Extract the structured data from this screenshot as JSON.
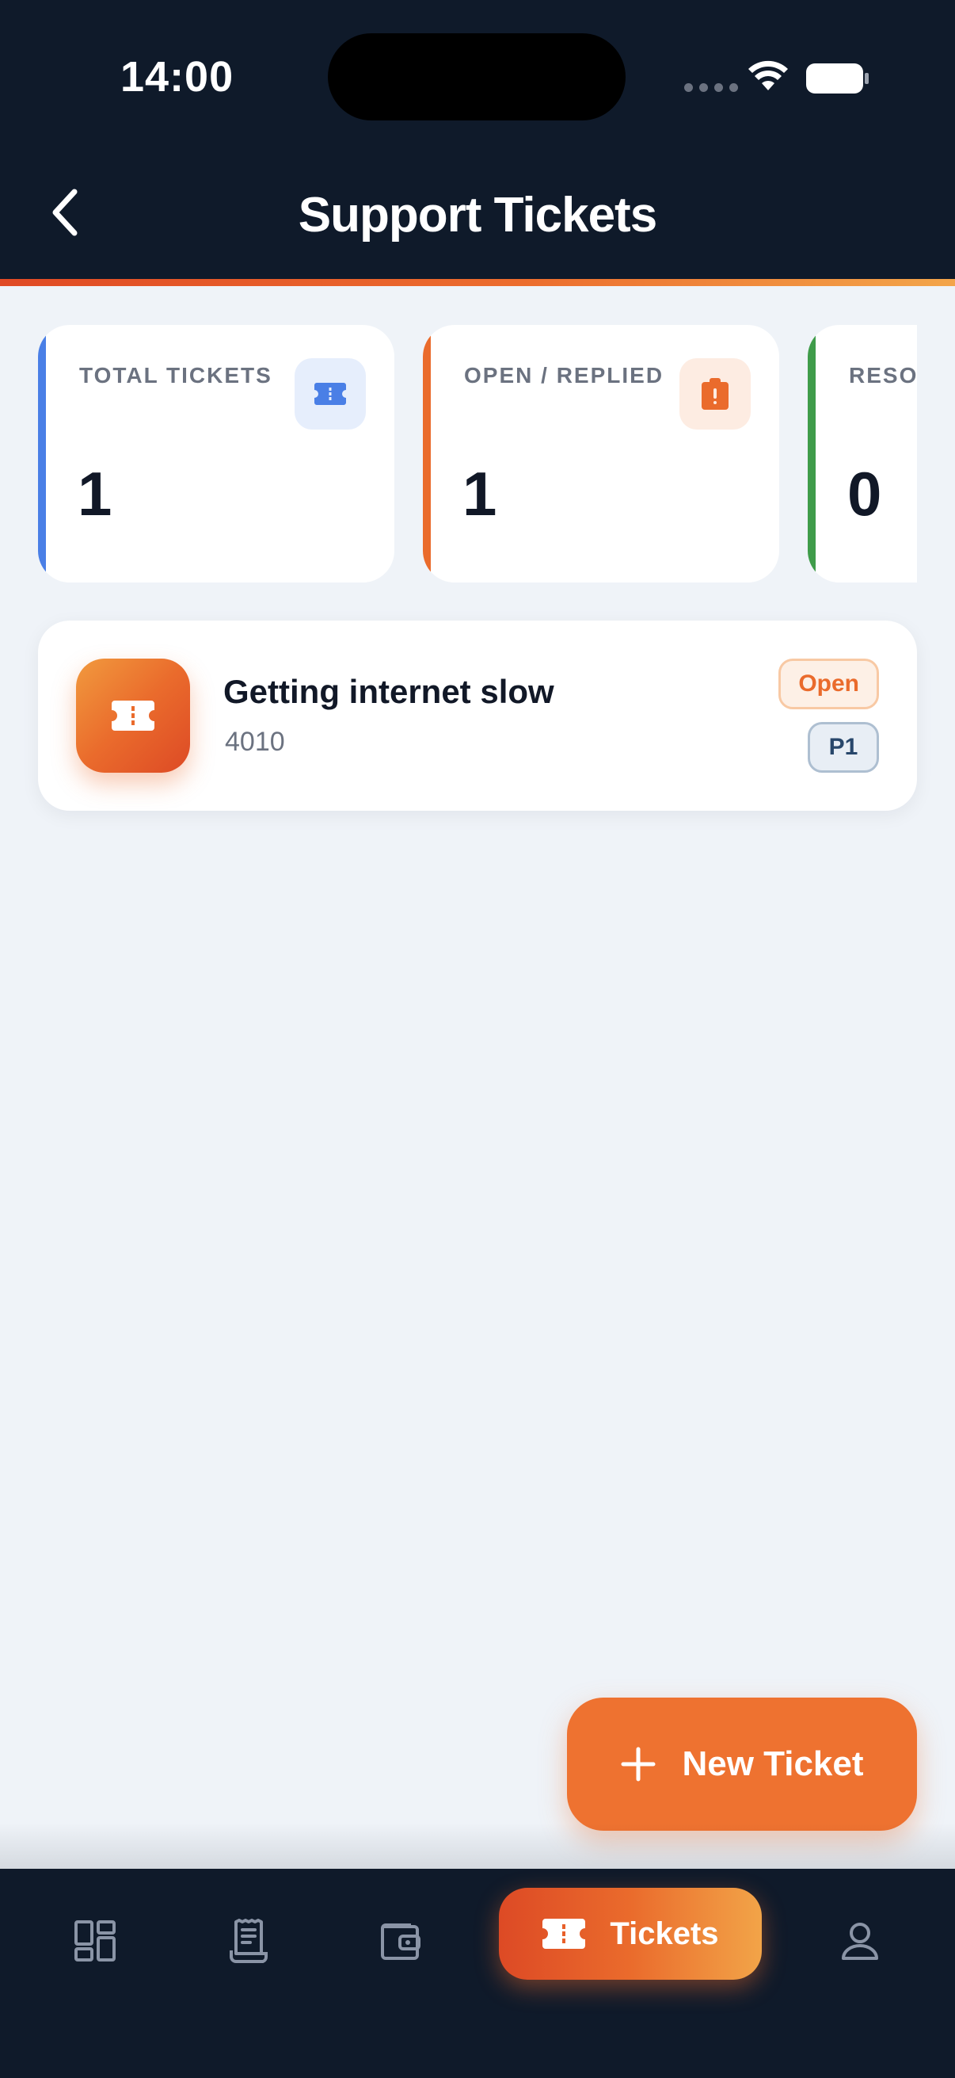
{
  "status_bar": {
    "time": "14:00"
  },
  "header": {
    "title": "Support Tickets"
  },
  "stats": [
    {
      "label": "TOTAL TICKETS",
      "value": "1",
      "accent": "#4a7fe6",
      "icon": "ticket-icon"
    },
    {
      "label": "OPEN / REPLIED",
      "value": "1",
      "accent": "#ea6b2c",
      "icon": "clipboard-alert-icon"
    },
    {
      "label": "RESO",
      "value": "0",
      "accent": "#3f9c4a",
      "icon": "check-icon"
    }
  ],
  "tickets": [
    {
      "title": "Getting internet slow",
      "id": "4010",
      "status": "Open",
      "priority": "P1"
    }
  ],
  "fab": {
    "label": "New Ticket"
  },
  "nav": {
    "items": [
      "dashboard-icon",
      "invoice-icon",
      "wallet-icon",
      "ticket-icon",
      "profile-icon"
    ],
    "active_label": "Tickets"
  },
  "colors": {
    "brand": "#ee7230",
    "header_bg": "#0f1a2a",
    "page_bg": "#eff3f8"
  }
}
